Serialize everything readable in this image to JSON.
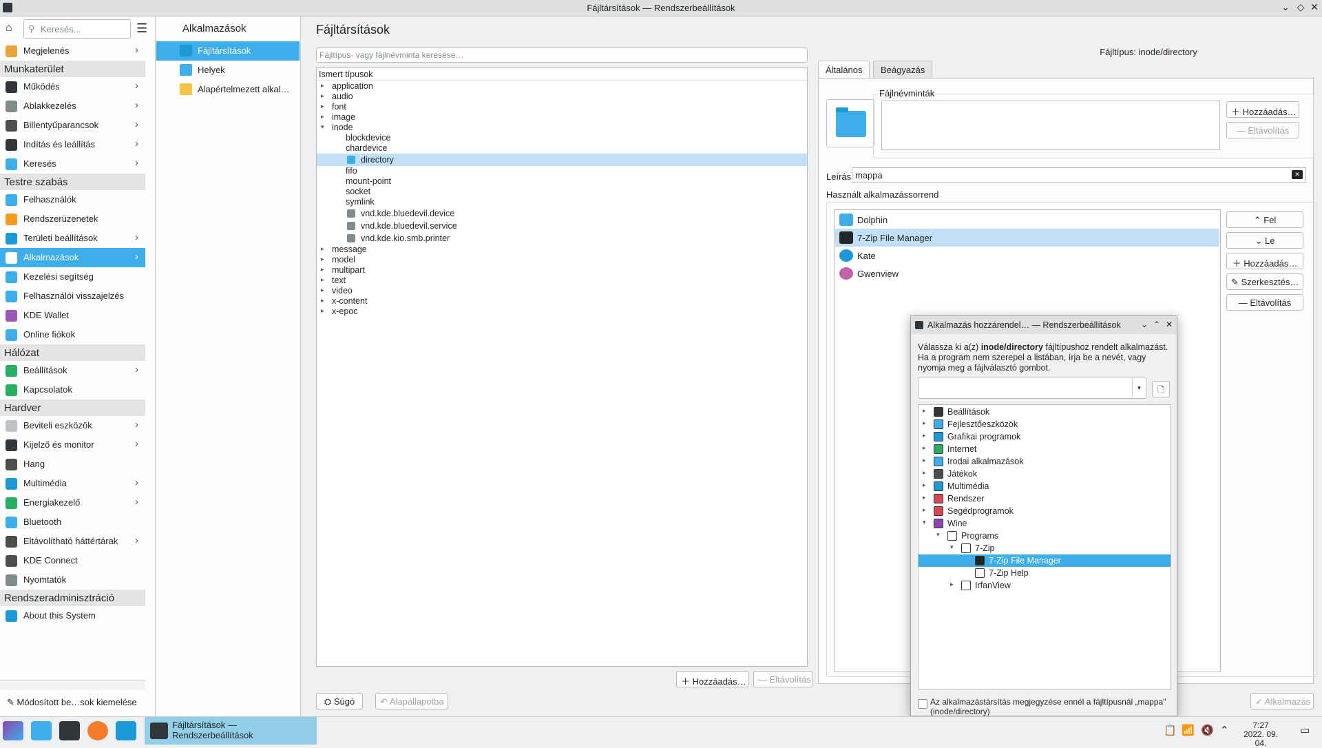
{
  "window": {
    "title": "Fájltársítások — Rendszerbeállítások"
  },
  "sidebar": {
    "search_placeholder": "Keresés...",
    "sections": [
      {
        "label": "Munkaterület"
      },
      {
        "label": "Testre szabás"
      },
      {
        "label": "Hálózat"
      },
      {
        "label": "Hardver"
      },
      {
        "label": "Rendszeradminisztráció"
      }
    ],
    "items": [
      {
        "label": "Megjelenés",
        "icon": "appearance-icon",
        "color": "#e8a33d",
        "chev": true
      },
      {
        "label": "Működés",
        "icon": "workspace-icon",
        "color": "#31363b",
        "chev": true
      },
      {
        "label": "Ablakkezelés",
        "icon": "window-icon",
        "color": "#7f8c8d",
        "chev": true
      },
      {
        "label": "Billentyűparancsok",
        "icon": "keyboard-icon",
        "color": "#4d4d4d",
        "chev": true
      },
      {
        "label": "Indítás és leállítás",
        "icon": "startup-icon",
        "color": "#31363b",
        "chev": true
      },
      {
        "label": "Keresés",
        "icon": "search-icon",
        "color": "#3daee9",
        "chev": true
      },
      {
        "label": "Felhasználók",
        "icon": "users-icon",
        "color": "#3daee9",
        "chev": false
      },
      {
        "label": "Rendszerüzenetek",
        "icon": "bell-icon",
        "color": "#f39c1f",
        "chev": false
      },
      {
        "label": "Területi beállítások",
        "icon": "region-icon",
        "color": "#1d99d8",
        "chev": true
      },
      {
        "label": "Alkalmazások",
        "icon": "apps-icon",
        "color": "#ffffff",
        "chev": true
      },
      {
        "label": "Kezelési segítség",
        "icon": "accessibility-icon",
        "color": "#3daee9",
        "chev": false
      },
      {
        "label": "Felhasználói visszajelzés",
        "icon": "feedback-icon",
        "color": "#3daee9",
        "chev": false
      },
      {
        "label": "KDE Wallet",
        "icon": "wallet-icon",
        "color": "#9b59b6",
        "chev": false
      },
      {
        "label": "Online fiókok",
        "icon": "online-accounts-icon",
        "color": "#3daee9",
        "chev": false
      },
      {
        "label": "Beállítások",
        "icon": "network-icon",
        "color": "#27ae60",
        "chev": true
      },
      {
        "label": "Kapcsolatok",
        "icon": "connections-icon",
        "color": "#27ae60",
        "chev": false
      },
      {
        "label": "Beviteli eszközök",
        "icon": "mouse-icon",
        "color": "#bdc3c7",
        "chev": true
      },
      {
        "label": "Kijelző és monitor",
        "icon": "monitor-icon",
        "color": "#31363b",
        "chev": true
      },
      {
        "label": "Hang",
        "icon": "audio-icon",
        "color": "#4d4d4d",
        "chev": false
      },
      {
        "label": "Multimédia",
        "icon": "multimedia-icon",
        "color": "#1d99d8",
        "chev": true
      },
      {
        "label": "Energiakezelő",
        "icon": "power-icon",
        "color": "#27ae60",
        "chev": true
      },
      {
        "label": "Bluetooth",
        "icon": "bluetooth-icon",
        "color": "#3daee9",
        "chev": false
      },
      {
        "label": "Eltávolítható háttértárak",
        "icon": "usb-icon",
        "color": "#4d4d4d",
        "chev": true
      },
      {
        "label": "KDE Connect",
        "icon": "phone-icon",
        "color": "#4d4d4d",
        "chev": false
      },
      {
        "label": "Nyomtatók",
        "icon": "printer-icon",
        "color": "#7f8c8d",
        "chev": false
      },
      {
        "label": "About this System",
        "icon": "info-icon",
        "color": "#1d99d8",
        "chev": false
      }
    ],
    "footer": "Módosított be…sok kiemelése"
  },
  "column2": {
    "title": "Alkalmazások",
    "items": [
      {
        "label": "Fájltársítások",
        "icon": "file-associations-icon",
        "color": "#1d99d8"
      },
      {
        "label": "Helyek",
        "icon": "folder-icon",
        "color": "#3daee9"
      },
      {
        "label": "Alapértelmezett alkal…",
        "icon": "star-icon",
        "color": "#f6c342"
      }
    ]
  },
  "main": {
    "title": "Fájltársítások",
    "search_placeholder": "Fájltípus- vagy fájlnévminta keresése…",
    "tree_header": "Ismert típusok",
    "tree": [
      {
        "label": "application",
        "level": 0,
        "arrow": "▸"
      },
      {
        "label": "audio",
        "level": 0,
        "arrow": "▸"
      },
      {
        "label": "font",
        "level": 0,
        "arrow": "▸"
      },
      {
        "label": "image",
        "level": 0,
        "arrow": "▸"
      },
      {
        "label": "inode",
        "level": 0,
        "arrow": "▾"
      },
      {
        "label": "blockdevice",
        "level": 1,
        "arrow": ""
      },
      {
        "label": "chardevice",
        "level": 1,
        "arrow": ""
      },
      {
        "label": "directory",
        "level": 1,
        "arrow": "",
        "icon": "folder-icon"
      },
      {
        "label": "fifo",
        "level": 1,
        "arrow": ""
      },
      {
        "label": "mount-point",
        "level": 1,
        "arrow": ""
      },
      {
        "label": "socket",
        "level": 1,
        "arrow": ""
      },
      {
        "label": "symlink",
        "level": 1,
        "arrow": ""
      },
      {
        "label": "vnd.kde.bluedevil.device",
        "level": 1,
        "arrow": "",
        "icon": "device-icon"
      },
      {
        "label": "vnd.kde.bluedevil.service",
        "level": 1,
        "arrow": "",
        "icon": "bluetooth-icon"
      },
      {
        "label": "vnd.kde.kio.smb.printer",
        "level": 1,
        "arrow": "",
        "icon": "printer-icon"
      },
      {
        "label": "message",
        "level": 0,
        "arrow": "▸"
      },
      {
        "label": "model",
        "level": 0,
        "arrow": "▸"
      },
      {
        "label": "multipart",
        "level": 0,
        "arrow": "▸"
      },
      {
        "label": "text",
        "level": 0,
        "arrow": "▸"
      },
      {
        "label": "video",
        "level": 0,
        "arrow": "▸"
      },
      {
        "label": "x-content",
        "level": 0,
        "arrow": "▸"
      },
      {
        "label": "x-epoc",
        "level": 0,
        "arrow": "▸"
      }
    ],
    "add_label": "Hozzáadás…",
    "remove_label": "Eltávolítás",
    "help_label": "Súgó",
    "reset_label": "Alapállapotba",
    "apply_label": "Alkalmazás"
  },
  "details": {
    "filetype_label": "Fájltípus: inode/directory",
    "tabs": [
      "Általános",
      "Beágyazás"
    ],
    "filename_patterns_label": "Fájlnévminták",
    "add_label": "Hozzáadás…",
    "remove_label": "Eltávolítás",
    "description_label": "Leírás:",
    "description_value": "mappa",
    "order_label": "Használt alkalmazássorrend",
    "apps": [
      {
        "label": "Dolphin",
        "icon": "dolphin-icon",
        "color": "#3daee9"
      },
      {
        "label": "7-Zip File Manager",
        "icon": "7zip-icon",
        "color": "#232627"
      },
      {
        "label": "Kate",
        "icon": "kate-icon",
        "color": "#1d99d8"
      },
      {
        "label": "Gwenview",
        "icon": "gwenview-icon",
        "color": "#c462a8"
      }
    ],
    "up_label": "Fel",
    "down_label": "Le",
    "add2_label": "Hozzáadás…",
    "edit_label": "Szerkesztés…",
    "remove2_label": "Eltávolítás"
  },
  "dialog": {
    "title": "Alkalmazás hozzárendel… — Rendszerbeállítások",
    "text_pre": "Válassza ki a(z) ",
    "text_bold": "inode/directory",
    "text_post": " fájltípushoz rendelt alkalmazást. Ha a program nem szerepel a listában, írja be a nevét, vagy nyomja meg a fájlválasztó gombot.",
    "tree": [
      {
        "label": "Beállítások",
        "level": 0,
        "arrow": "▸",
        "icon": "settings-icon",
        "color": "#31363b"
      },
      {
        "label": "Fejlesztőeszközök",
        "level": 0,
        "arrow": "▸",
        "icon": "development-icon",
        "color": "#3daee9"
      },
      {
        "label": "Grafikai programok",
        "level": 0,
        "arrow": "▸",
        "icon": "graphics-icon",
        "color": "#1d99d8"
      },
      {
        "label": "Internet",
        "level": 0,
        "arrow": "▸",
        "icon": "internet-icon",
        "color": "#27ae60"
      },
      {
        "label": "Irodai alkalmazások",
        "level": 0,
        "arrow": "▸",
        "icon": "office-icon",
        "color": "#3daee9"
      },
      {
        "label": "Játékok",
        "level": 0,
        "arrow": "▸",
        "icon": "games-icon",
        "color": "#4d4d4d"
      },
      {
        "label": "Multimédia",
        "level": 0,
        "arrow": "▸",
        "icon": "multimedia-icon",
        "color": "#1d99d8"
      },
      {
        "label": "Rendszer",
        "level": 0,
        "arrow": "▸",
        "icon": "system-icon",
        "color": "#da4453"
      },
      {
        "label": "Segédprogramok",
        "level": 0,
        "arrow": "▸",
        "icon": "utilities-icon",
        "color": "#da4453"
      },
      {
        "label": "Wine",
        "level": 0,
        "arrow": "▾",
        "icon": "wine-icon",
        "color": "#8e44ad"
      },
      {
        "label": "Programs",
        "level": 1,
        "arrow": "▾",
        "icon": "folder-icon",
        "color": "#ffffff"
      },
      {
        "label": "7-Zip",
        "level": 2,
        "arrow": "▾",
        "icon": "folder-icon",
        "color": "#ffffff"
      },
      {
        "label": "7-Zip File Manager",
        "level": 3,
        "arrow": "",
        "icon": "7zip-icon",
        "color": "#232627",
        "sel": true
      },
      {
        "label": "7-Zip Help",
        "level": 3,
        "arrow": "",
        "icon": "help-icon",
        "color": "#ffffff"
      },
      {
        "label": "IrfanView",
        "level": 2,
        "arrow": "▸",
        "icon": "folder-icon",
        "color": "#ffffff"
      }
    ],
    "remember_label": "Az alkalmazástársítás megjegyzése ennél a fájltípusnál „mappa\" (inode/directory)"
  },
  "taskbar": {
    "task_label": "Fájltársítások — Rendszerbeállítások",
    "time": "7:27",
    "date": "2022. 09. 04."
  },
  "colors": {
    "accent": "#3daee9",
    "selection_light": "#c2e0f5"
  }
}
